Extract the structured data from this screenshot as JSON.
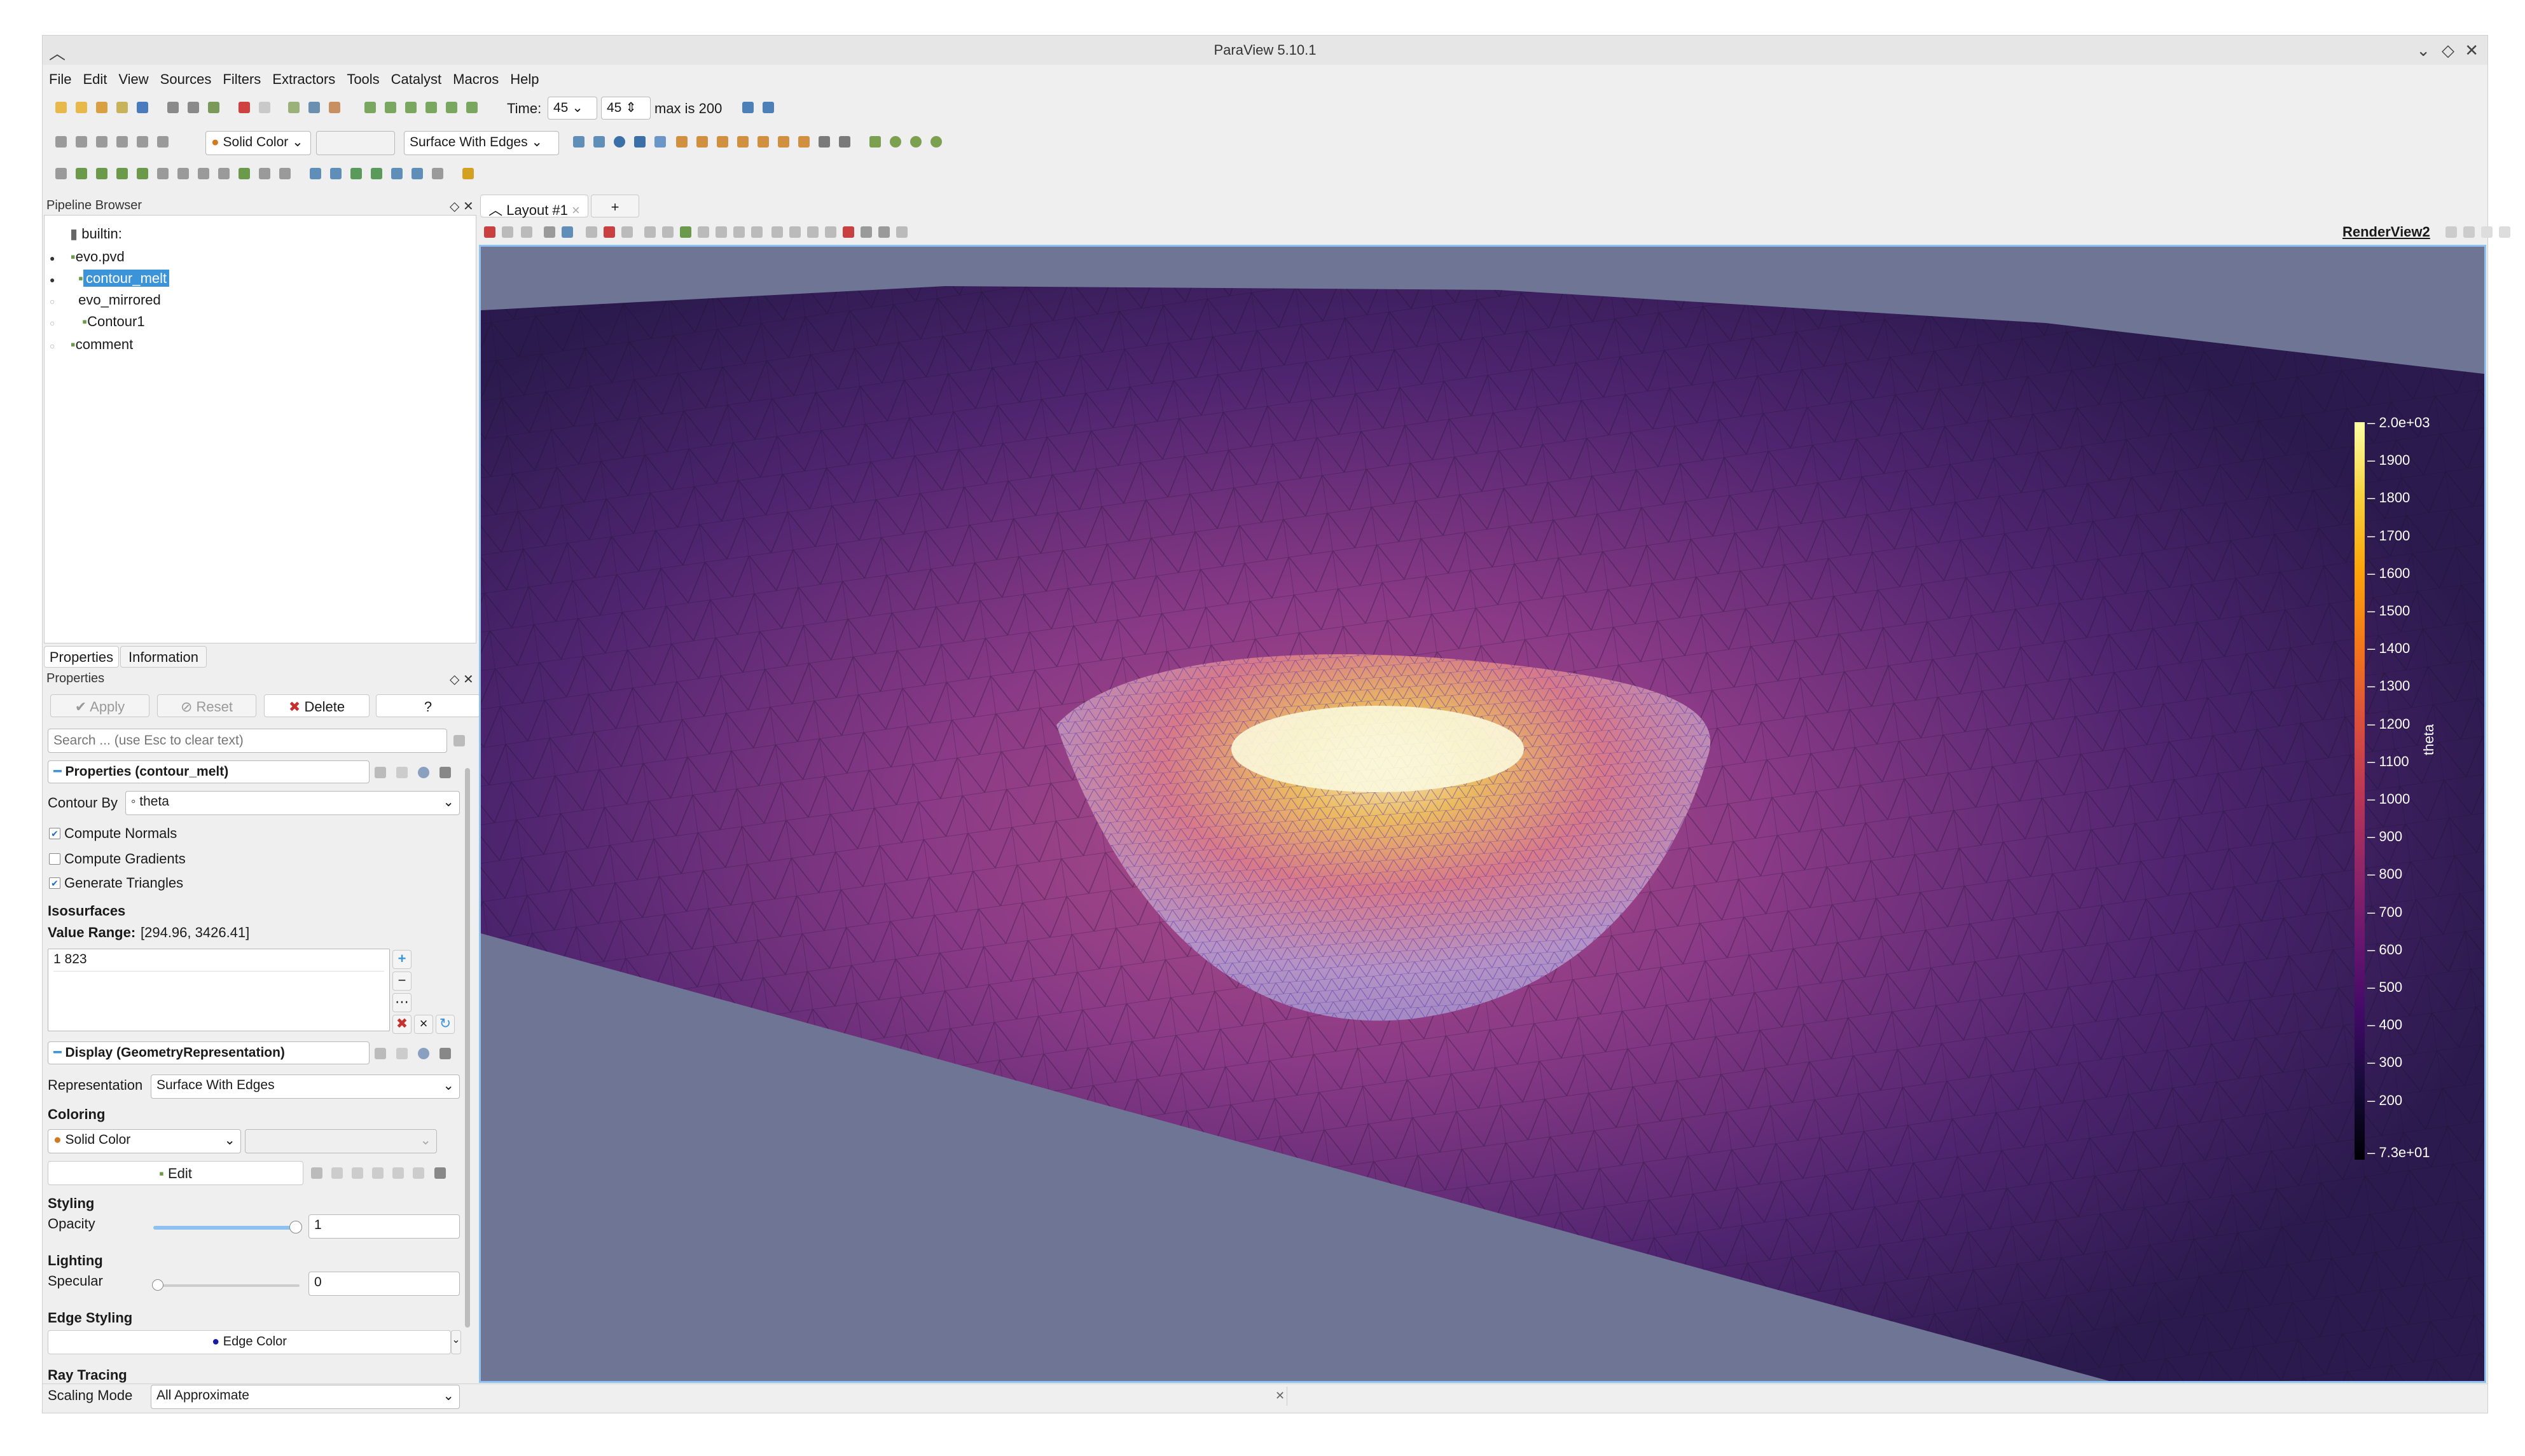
{
  "window": {
    "title": "ParaView 5.10.1"
  },
  "menu": [
    "File",
    "Edit",
    "View",
    "Sources",
    "Filters",
    "Extractors",
    "Tools",
    "Catalyst",
    "Macros",
    "Help"
  ],
  "toolbar": {
    "time_label": "Time:",
    "time_value": "45",
    "time_index": "45",
    "time_max": "max is 200",
    "color_by": "Solid Color",
    "representation": "Surface With Edges"
  },
  "pipeline": {
    "title": "Pipeline Browser",
    "items": [
      {
        "label": "builtin:"
      },
      {
        "label": "evo.pvd"
      },
      {
        "label": "contour_melt"
      },
      {
        "label": "evo_mirrored"
      },
      {
        "label": "Contour1"
      },
      {
        "label": "comment"
      }
    ]
  },
  "props": {
    "tabs": [
      "Properties",
      "Information"
    ],
    "header": "Properties",
    "apply": "Apply",
    "reset": "Reset",
    "delete": "Delete",
    "help": "?",
    "search_placeholder": "Search ... (use Esc to clear text)",
    "section_properties": "Properties (contour_melt)",
    "contour_by_label": "Contour By",
    "contour_by_value": "theta",
    "compute_normals": "Compute Normals",
    "compute_gradients": "Compute Gradients",
    "generate_triangles": "Generate Triangles",
    "isosurfaces": "Isosurfaces",
    "value_range_label": "Value Range:",
    "value_range": "[294.96, 3426.41]",
    "iso_value": "1 823",
    "section_display": "Display (GeometryRepresentation)",
    "representation_label": "Representation",
    "representation_value": "Surface With Edges",
    "coloring": "Coloring",
    "coloring_value": "Solid Color",
    "edit": "Edit",
    "styling": "Styling",
    "opacity_label": "Opacity",
    "opacity_value": "1",
    "lighting": "Lighting",
    "specular_label": "Specular",
    "specular_value": "0",
    "edge_styling": "Edge Styling",
    "edge_color": "Edge Color",
    "ray_tracing": "Ray Tracing",
    "scaling_mode_label": "Scaling Mode",
    "scaling_mode_value": "All Approximate"
  },
  "layout": {
    "tab": "Layout #1",
    "add": "+",
    "view_name": "RenderView2"
  },
  "colorbar": {
    "title": "theta",
    "ticks": [
      "2.0e+03",
      "1900",
      "1800",
      "1700",
      "1600",
      "1500",
      "1400",
      "1300",
      "1200",
      "1100",
      "1000",
      "900",
      "800",
      "700",
      "600",
      "500",
      "400",
      "300",
      "200",
      "7.3e+01"
    ]
  },
  "colors": {
    "accent": "#3b94d9",
    "background": "#6f7695"
  }
}
